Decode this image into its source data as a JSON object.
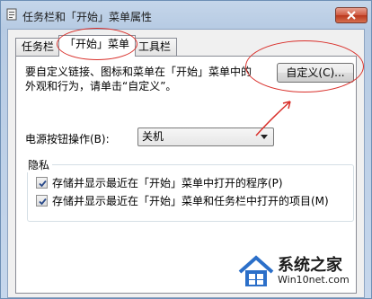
{
  "window": {
    "title": "任务栏和「开始」菜单属性"
  },
  "tabs": [
    {
      "label": "任务栏",
      "active": false
    },
    {
      "label": "「开始」菜单",
      "active": true
    },
    {
      "label": "工具栏",
      "active": false
    }
  ],
  "start_menu": {
    "description_line1": "要自定义链接、图标和菜单在「开始」菜单中的",
    "description_line2": "外观和行为，请单击“自定义”。",
    "customize_button": "自定义(C)...",
    "power_button_label": "电源按钮操作(B):",
    "power_button_value": "关机",
    "privacy_group_title": "隐私",
    "privacy_options": [
      {
        "label": "存储并显示最近在「开始」菜单中打开的程序(P)",
        "checked": true
      },
      {
        "label": "存储并显示最近在「开始」菜单和任务栏中打开的项目(M)",
        "checked": true
      }
    ]
  },
  "watermark": {
    "brand": "系统之家",
    "site": "Win10net.com"
  },
  "colors": {
    "annotation_red": "#d9302b",
    "close_button": "#cf5a40"
  }
}
